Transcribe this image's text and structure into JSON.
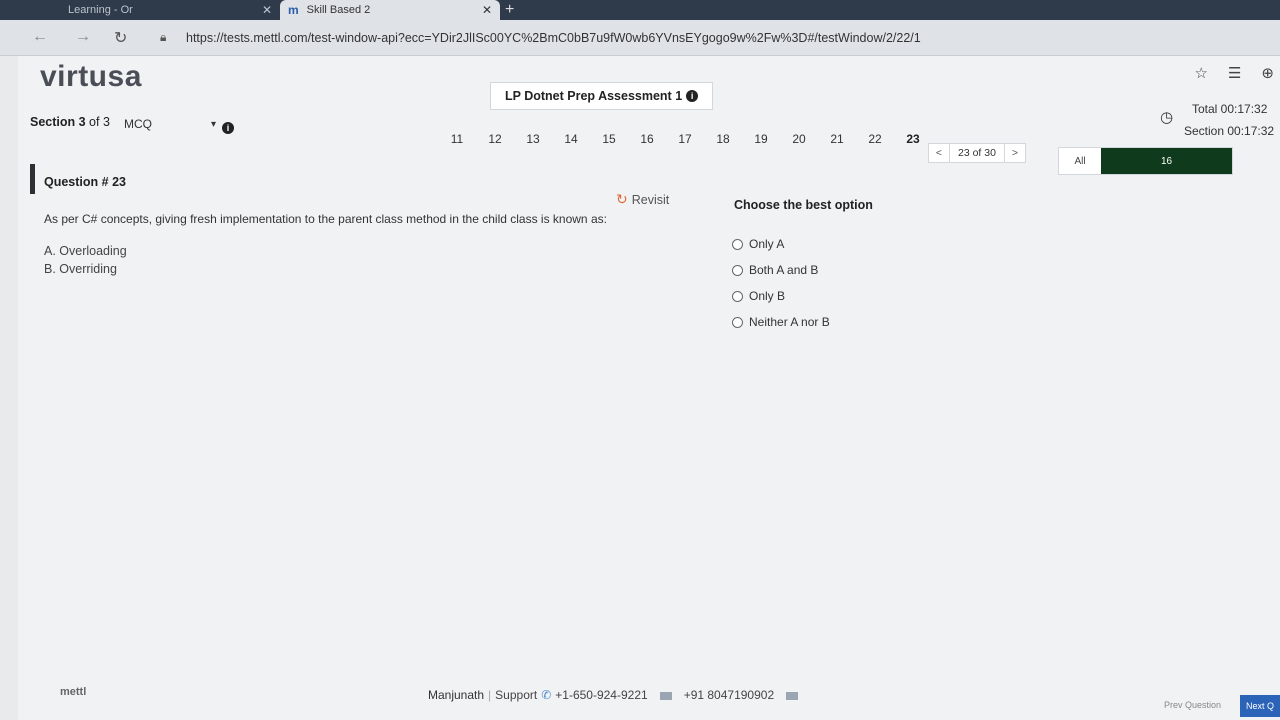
{
  "browser": {
    "tab_inactive": "Learning - Or",
    "tab_active": "Skill Based 2",
    "tab_active_icon": "m",
    "url": "https://tests.mettl.com/test-window-api?ecc=YDir2JlISc00YC%2BmC0bB7u9fW0wb6YVnsEYgogo9w%2Fw%3D#/testWindow/2/22/1"
  },
  "header": {
    "logo": "virtusa",
    "assessment_title": "LP Dotnet Prep Assessment 1",
    "timer_total": "Total 00:17:32",
    "timer_section": "Section 00:17:32"
  },
  "section": {
    "label_prefix": "Section 3",
    "label_suffix": " of 3",
    "selected": "MCQ"
  },
  "question_numbers": [
    "11",
    "12",
    "13",
    "14",
    "15",
    "16",
    "17",
    "18",
    "19",
    "20",
    "21",
    "22",
    "23"
  ],
  "pager": {
    "prev": "<",
    "count": "23 of 30",
    "next": ">"
  },
  "filter": {
    "all_label": "All",
    "count": "16"
  },
  "question": {
    "title": "Question # 23",
    "revisit_label": "Revisit",
    "text": "As per C# concepts, giving fresh implementation to the parent class method in the child class is known as:",
    "option_a": "A. Overloading",
    "option_b": "B. Overriding"
  },
  "answers": {
    "heading": "Choose the best option",
    "options": [
      "Only A",
      "Both A and B",
      "Only B",
      "Neither A nor B"
    ]
  },
  "footer": {
    "brand": "mettl",
    "name": "Manjunath",
    "support": "Support",
    "phone_us": "+1-650-924-9221",
    "phone_in": "+91 8047190902",
    "prev_question": "Prev Question",
    "next_question": "Next Q"
  }
}
